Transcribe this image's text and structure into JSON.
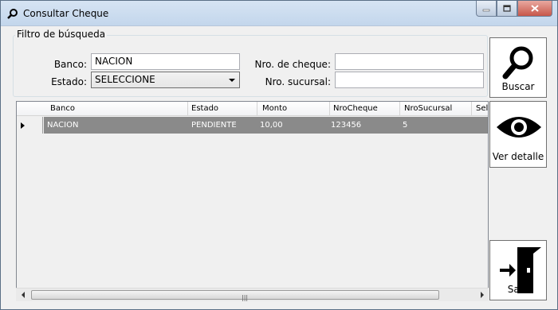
{
  "window": {
    "title": "Consultar Cheque"
  },
  "filter": {
    "legend": "Filtro de búsqueda",
    "banco_label": "Banco:",
    "banco_value": "NACION",
    "estado_label": "Estado:",
    "estado_value": "SELECCIONE",
    "nro_cheque_label": "Nro. de cheque:",
    "nro_cheque_value": "",
    "nro_sucursal_label": "Nro. sucursal:",
    "nro_sucursal_value": ""
  },
  "buttons": {
    "buscar": "Buscar",
    "ver_detalle": "Ver detalle",
    "salir": "Salir"
  },
  "grid": {
    "columns": [
      "Banco",
      "Estado",
      "Monto",
      "NroCheque",
      "NroSucursal",
      "Sele"
    ],
    "rows": [
      {
        "banco": "NACION",
        "estado": "PENDIENTE",
        "monto": "10,00",
        "nro_cheque": "123456",
        "nro_sucursal": "5"
      }
    ]
  },
  "icons": [
    "search-icon",
    "eye-icon",
    "exit-door-icon",
    "row-indicator-icon"
  ]
}
